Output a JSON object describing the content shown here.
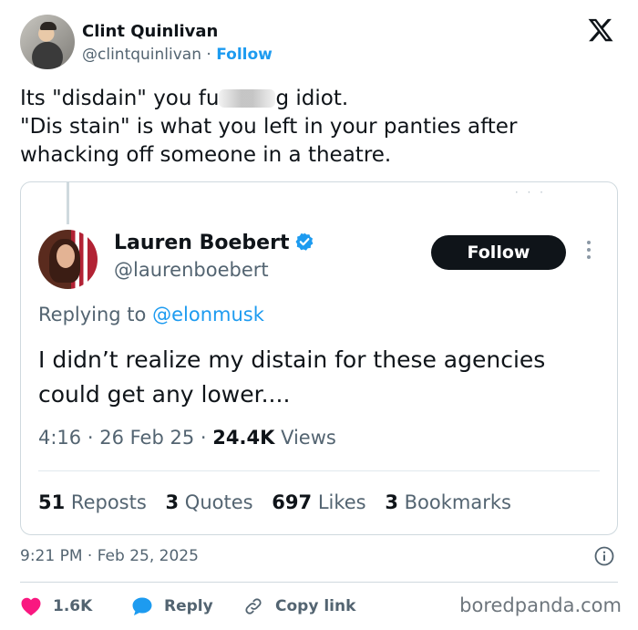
{
  "author": {
    "display_name": "Clint Quinlivan",
    "handle": "@clintquinlivan",
    "separator": "·",
    "follow_label": "Follow"
  },
  "tweet": {
    "text_part1": "Its \"disdain\" you fu",
    "text_part2": "g idiot.",
    "text_line2": "\"Dis stain\" is what you left in your panties after whacking off someone in a theatre."
  },
  "quoted_tweet": {
    "display_name": "Lauren Boebert",
    "handle": "@laurenboebert",
    "follow_label": "Follow",
    "replying_prefix": "Replying to",
    "replying_to": "@elonmusk",
    "text": "I didn’t realize my distain for these agencies could get any lower....",
    "time": "4:16",
    "date": "26 Feb 25",
    "sep": "·",
    "views_count": "24.4K",
    "views_label": "Views",
    "stats": {
      "reposts_count": "51",
      "reposts_label": "Reposts",
      "quotes_count": "3",
      "quotes_label": "Quotes",
      "likes_count": "697",
      "likes_label": "Likes",
      "bookmarks_count": "3",
      "bookmarks_label": "Bookmarks"
    }
  },
  "footer": {
    "timestamp": "9:21 PM · Feb 25, 2025",
    "likes": "1.6K",
    "reply_label": "Reply",
    "copy_link_label": "Copy link",
    "watermark": "boredpanda.com"
  },
  "icons": {
    "x_logo": "x-logo-icon",
    "verified": "verified-badge-icon",
    "info": "info-icon",
    "like": "heart-icon",
    "reply": "speech-bubble-icon",
    "copy": "link-icon"
  },
  "colors": {
    "accent": "#1d9bf0",
    "like": "#f91880",
    "text": "#0f1419",
    "muted": "#536471"
  }
}
